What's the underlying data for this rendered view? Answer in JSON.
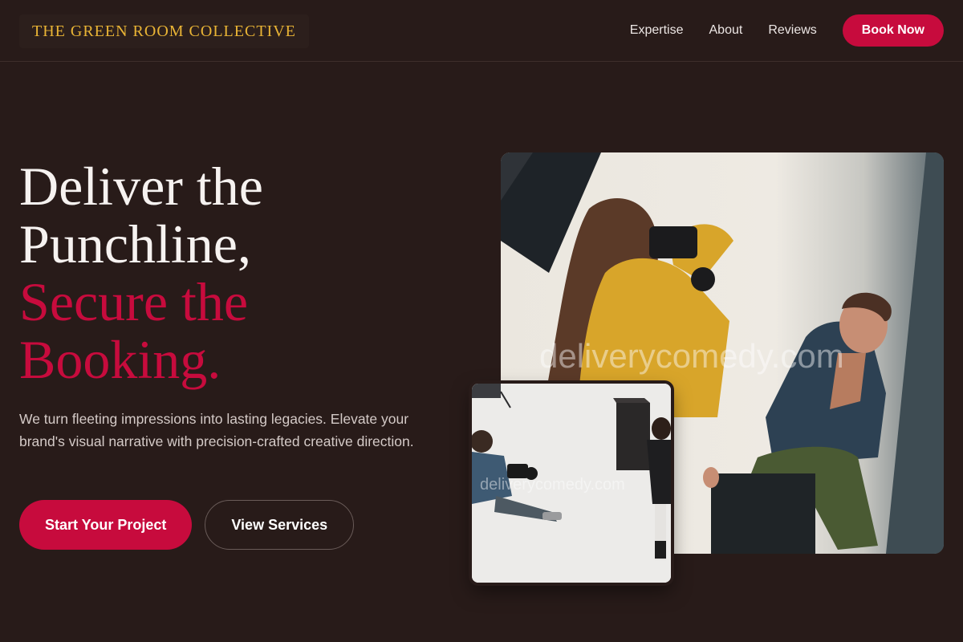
{
  "header": {
    "logo": "THE GREEN ROOM COLLECTIVE",
    "nav": [
      "Expertise",
      "About",
      "Reviews"
    ],
    "cta": "Book Now"
  },
  "hero": {
    "title_line1": "Deliver the",
    "title_line2": "Punchline,",
    "accent_line1": "Secure the",
    "accent_line2": "Booking.",
    "copy": "We turn fleeting impressions into lasting legacies. Elevate your brand's visual narrative with precision-crafted creative direction.",
    "primary_cta": "Start Your Project",
    "secondary_cta": "View Services"
  },
  "images": {
    "main_watermark": "deliverycomedy.com",
    "small_watermark": "deliverycomedy.com"
  },
  "colors": {
    "background": "#281b19",
    "accent": "#c70b3d",
    "logo_gold": "#e9b435"
  }
}
